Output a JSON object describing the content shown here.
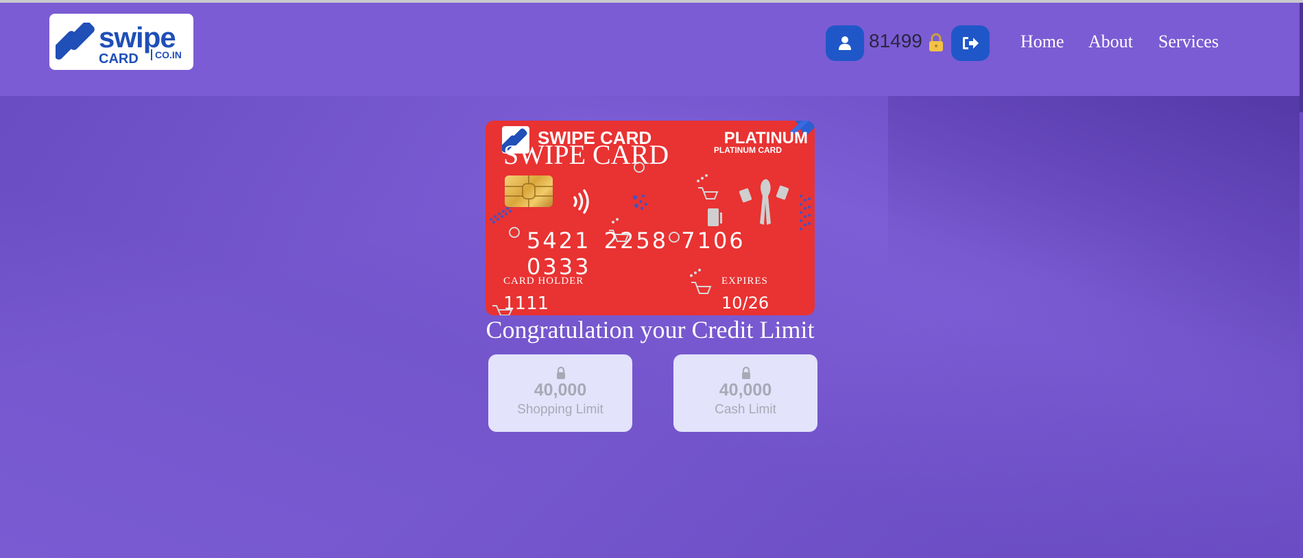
{
  "brand": {
    "logo_word": "swipe",
    "logo_card": "CARD",
    "logo_domain": "CO.IN"
  },
  "header": {
    "user_id": "81499",
    "nav": [
      {
        "label": "Home"
      },
      {
        "label": "About"
      },
      {
        "label": "Services"
      }
    ]
  },
  "card": {
    "brand": "SWIPE CARD",
    "brand_overlay": "SWIPE CARD",
    "tier": "PLATINUM",
    "tier_sub": "PLATINUM CARD",
    "number": "5421 2258 7106 0333",
    "holder_label": "CARD HOLDER",
    "holder_value": "1111",
    "expires_label": "EXPIRES",
    "expires_value": "10/26",
    "color": "#e93232"
  },
  "message": "Congratulation your Credit Limit",
  "limits": [
    {
      "amount": "40,000",
      "label": "Shopping Limit"
    },
    {
      "amount": "40,000",
      "label": "Cash Limit"
    }
  ],
  "colors": {
    "page_bg": "#7a5bd2",
    "accent_button": "#1f57c8",
    "limit_box_bg": "#e3e3fc"
  },
  "icons": {
    "user": "user-icon",
    "lock": "lock-icon",
    "logout": "logout-icon"
  }
}
